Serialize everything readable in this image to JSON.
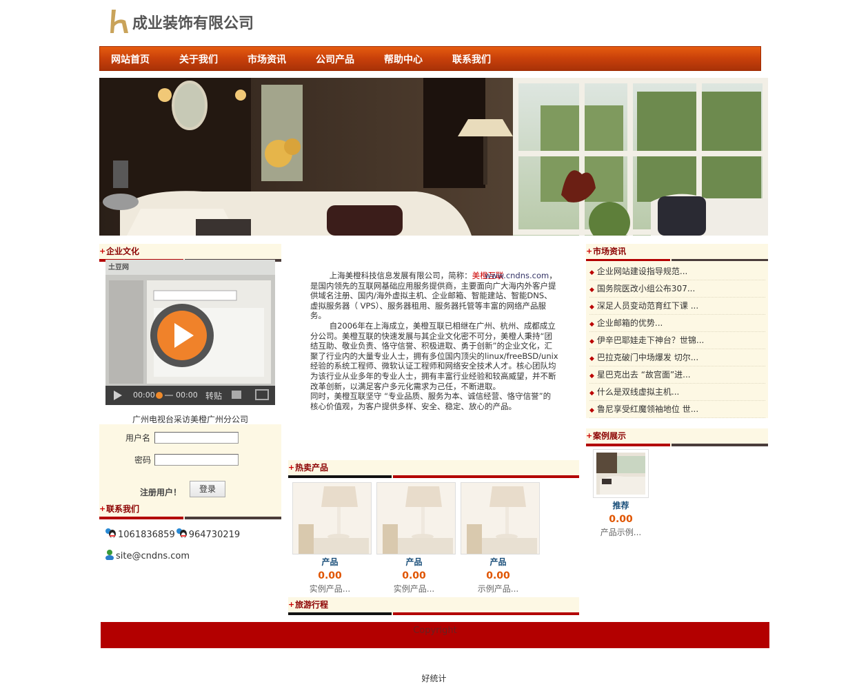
{
  "logo": {
    "company_name": "成业装饰有限公司"
  },
  "nav": {
    "items": [
      {
        "label": "网站首页"
      },
      {
        "label": "关于我们"
      },
      {
        "label": "市场资讯"
      },
      {
        "label": "公司产品"
      },
      {
        "label": "帮助中心"
      },
      {
        "label": "联系我们"
      }
    ]
  },
  "sections": {
    "culture": "企业文化",
    "contact": "联系我们",
    "hot_products": "热卖产品",
    "travel": "旅游行程",
    "news": "市场资讯",
    "cases": "案例展示"
  },
  "video": {
    "site_logo": "土豆网",
    "time_current": "00:00",
    "time_total": "00:00",
    "share_label": "转贴",
    "caption": "广州电视台采访美橙广州分公司"
  },
  "login": {
    "username_label": "用户名",
    "password_label": "密码",
    "register_label": "注册用户！",
    "login_button": "登录",
    "username_value": "",
    "password_value": ""
  },
  "contact": {
    "qq1": "1061836859",
    "qq2": "964730219",
    "email": "site@cndns.com"
  },
  "intro": {
    "p1_prefix": "上海美橙科技信息发展有限公司，简称：",
    "p1_brand": "美橙互联",
    "p1_url": "www.cndns.com",
    "p1_body": "，是国内领先的互联网基础应用服务提供商，主要面向广大海内外客户提供域名注册、国内/海外虚拟主机、企业邮箱、智能建站、智能DNS、虚拟服务器（ VPS）、服务器租用、服务器托管等丰富的网络产品服务。",
    "p2": "自2006年在上海成立，美橙互联已相继在广州、杭州、成都成立分公司。美橙互联的快速发展与其企业文化密不可分，美橙人秉持“团结互助、敬业负责、恪守信誉、积极进取、勇于创新”的企业文化，汇聚了行业内的大量专业人士，拥有多位国内顶尖的linux/freeBSD/unix经验的系统工程师、微软认证工程师和网络安全技术人才。核心团队均为该行业从业多年的专业人士，拥有丰富行业经验和较高威望，并不断改革创新，以满足客户多元化需求为己任，不断进取。",
    "p3": "同时，美橙互联坚守 “专业品质、服务为本、诚信经营、恪守信誉”的核心价值观，为客户提供多样、安全、稳定、放心的产品。"
  },
  "products": [
    {
      "name": "产品",
      "price": "0.00",
      "desc": "实例产品..."
    },
    {
      "name": "产品",
      "price": "0.00",
      "desc": "实例产品..."
    },
    {
      "name": "产品",
      "price": "0.00",
      "desc": "示例产品..."
    }
  ],
  "news": [
    {
      "title": "企业网站建设指导规范..."
    },
    {
      "title": "国务院医改小组公布307..."
    },
    {
      "title": "深足人员变动范育红下课 ..."
    },
    {
      "title": "企业邮箱的优势..."
    },
    {
      "title": "伊辛巴耶娃走下神台？世锦..."
    },
    {
      "title": "巴拉克破门中场爆发 切尔..."
    },
    {
      "title": "星巴克出去 “故宫面”进..."
    },
    {
      "title": "什么是双线虚拟主机..."
    },
    {
      "title": "鲁尼享受红魔领袖地位 世..."
    }
  ],
  "case": {
    "name": "推荐",
    "price": "0.00",
    "desc": "产品示例..."
  },
  "footer": {
    "copyright": "Copyright"
  },
  "stats": {
    "label": "好统计"
  },
  "colors": {
    "nav_orange": "#d04a0c",
    "accent_red": "#b30000",
    "cream": "#fdf8e4",
    "price_orange": "#e05500",
    "link_blue": "#1a4f7a"
  }
}
